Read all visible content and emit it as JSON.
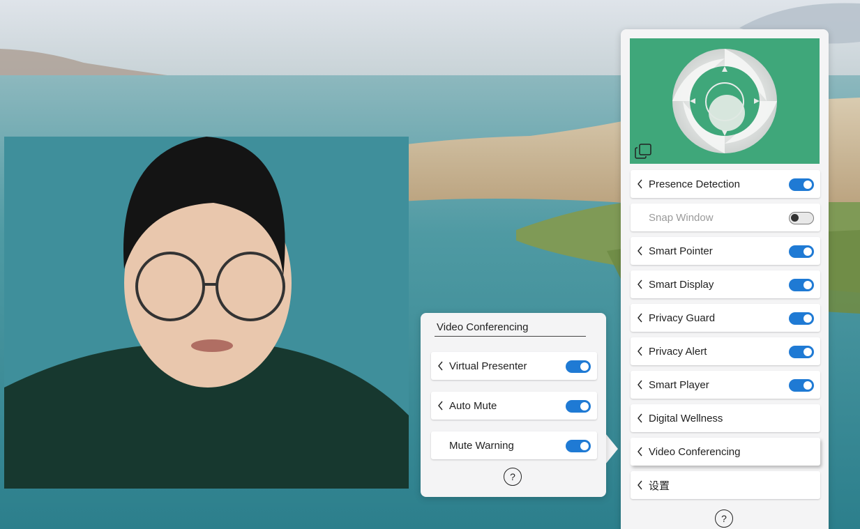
{
  "main_panel": {
    "items": [
      {
        "label": "Presence Detection",
        "has_chevron": true,
        "toggle": "on",
        "disabled": false
      },
      {
        "label": "Snap Window",
        "has_chevron": false,
        "toggle": "off",
        "disabled": true
      },
      {
        "label": "Smart Pointer",
        "has_chevron": true,
        "toggle": "on",
        "disabled": false
      },
      {
        "label": "Smart Display",
        "has_chevron": true,
        "toggle": "on",
        "disabled": false
      },
      {
        "label": "Privacy Guard",
        "has_chevron": true,
        "toggle": "on",
        "disabled": false
      },
      {
        "label": "Privacy Alert",
        "has_chevron": true,
        "toggle": "on",
        "disabled": false
      },
      {
        "label": "Smart Player",
        "has_chevron": true,
        "toggle": "on",
        "disabled": false
      },
      {
        "label": "Digital Wellness",
        "has_chevron": true,
        "toggle": null,
        "disabled": false
      },
      {
        "label": "Video Conferencing",
        "has_chevron": true,
        "toggle": null,
        "disabled": false,
        "active": true
      },
      {
        "label": "设置",
        "has_chevron": true,
        "toggle": null,
        "disabled": false
      }
    ],
    "help_label": "?",
    "hero_icon": "aperture-logo-icon",
    "hero_color": "#3fa77a"
  },
  "vc_panel": {
    "title": "Video Conferencing",
    "items": [
      {
        "label": "Virtual Presenter",
        "has_chevron": true,
        "toggle": "on"
      },
      {
        "label": "Auto Mute",
        "has_chevron": true,
        "toggle": "on"
      },
      {
        "label": "Mute Warning",
        "has_chevron": false,
        "toggle": "on"
      }
    ],
    "help_label": "?"
  },
  "colors": {
    "toggle_on": "#1f7ad4",
    "panel_bg": "#f4f4f5"
  }
}
